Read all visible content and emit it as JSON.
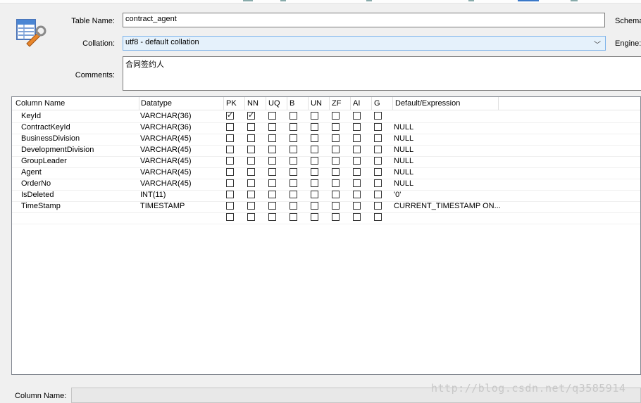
{
  "form": {
    "table_name_label": "Table Name:",
    "table_name_value": "contract_agent",
    "schema_label": "Schema",
    "collation_label": "Collation:",
    "collation_value": "utf8 - default collation",
    "engine_label": "Engine:",
    "comments_label": "Comments:",
    "comments_value": "合同签约人"
  },
  "grid": {
    "headers": [
      "Column Name",
      "Datatype",
      "PK",
      "NN",
      "UQ",
      "B",
      "UN",
      "ZF",
      "AI",
      "G",
      "Default/Expression"
    ],
    "rows": [
      {
        "name": "KeyId",
        "type": "VARCHAR(36)",
        "flags": [
          true,
          true,
          false,
          false,
          false,
          false,
          false,
          false
        ],
        "default": ""
      },
      {
        "name": "ContractKeyId",
        "type": "VARCHAR(36)",
        "flags": [
          false,
          false,
          false,
          false,
          false,
          false,
          false,
          false
        ],
        "default": "NULL"
      },
      {
        "name": "BusinessDivision",
        "type": "VARCHAR(45)",
        "flags": [
          false,
          false,
          false,
          false,
          false,
          false,
          false,
          false
        ],
        "default": "NULL"
      },
      {
        "name": "DevelopmentDivision",
        "type": "VARCHAR(45)",
        "flags": [
          false,
          false,
          false,
          false,
          false,
          false,
          false,
          false
        ],
        "default": "NULL"
      },
      {
        "name": "GroupLeader",
        "type": "VARCHAR(45)",
        "flags": [
          false,
          false,
          false,
          false,
          false,
          false,
          false,
          false
        ],
        "default": "NULL"
      },
      {
        "name": "Agent",
        "type": "VARCHAR(45)",
        "flags": [
          false,
          false,
          false,
          false,
          false,
          false,
          false,
          false
        ],
        "default": "NULL"
      },
      {
        "name": "OrderNo",
        "type": "VARCHAR(45)",
        "flags": [
          false,
          false,
          false,
          false,
          false,
          false,
          false,
          false
        ],
        "default": "NULL"
      },
      {
        "name": "IsDeleted",
        "type": "INT(11)",
        "flags": [
          false,
          false,
          false,
          false,
          false,
          false,
          false,
          false
        ],
        "default": "'0'"
      },
      {
        "name": "TimeStamp",
        "type": "TIMESTAMP",
        "flags": [
          false,
          false,
          false,
          false,
          false,
          false,
          false,
          false
        ],
        "default": "CURRENT_TIMESTAMP ON..."
      },
      {
        "name": "",
        "type": "",
        "flags": [
          false,
          false,
          false,
          false,
          false,
          false,
          false,
          false
        ],
        "default": ""
      }
    ]
  },
  "detail": {
    "column_name_label": "Column Name:"
  },
  "watermark": "http://blog.csdn.net/q3585914"
}
